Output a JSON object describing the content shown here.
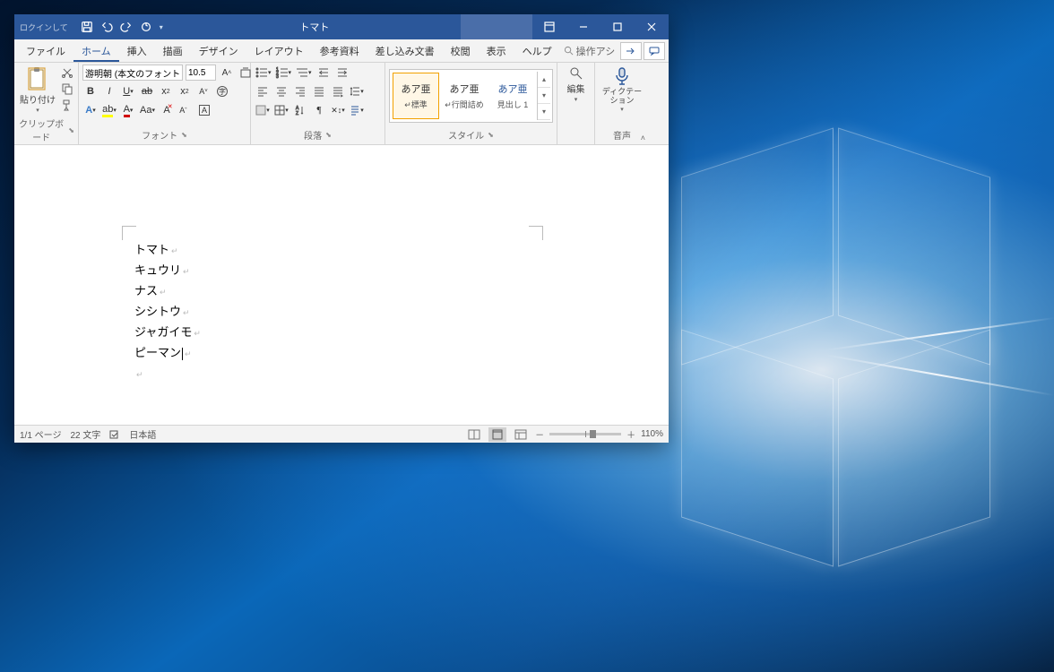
{
  "titlebar": {
    "badge": "ロクインして",
    "doc_title": "トマト"
  },
  "window_controls": {
    "min": "—",
    "max": "▢",
    "close": "✕"
  },
  "menu": {
    "items": [
      "ファイル",
      "ホーム",
      "挿入",
      "描画",
      "デザイン",
      "レイアウト",
      "参考資料",
      "差し込み文書",
      "校閲",
      "表示",
      "ヘルプ"
    ],
    "active_index": 1,
    "search_placeholder": "操作アシ"
  },
  "ribbon": {
    "clipboard": {
      "paste": "貼り付け",
      "group_label": "クリップボード"
    },
    "font": {
      "font_name": "游明朝 (本文のフォント - 日",
      "font_size": "10.5",
      "group_label": "フォント"
    },
    "paragraph": {
      "group_label": "段落"
    },
    "styles": {
      "items": [
        {
          "sample": "あア亜",
          "name": "標準",
          "selected": true,
          "prefix": "↵"
        },
        {
          "sample": "あア亜",
          "name": "行間詰め",
          "selected": false,
          "prefix": "↵"
        },
        {
          "sample": "あア亜",
          "name": "見出し 1",
          "selected": false,
          "prefix": ""
        }
      ],
      "group_label": "スタイル"
    },
    "editing": {
      "label": "編集"
    },
    "voice": {
      "label": "ディクテーション",
      "group_label": "音声"
    }
  },
  "document": {
    "lines": [
      "トマト",
      "キュウリ",
      "ナス",
      "シシトウ",
      "ジャガイモ",
      "ピーマン"
    ]
  },
  "status": {
    "page": "1/1 ページ",
    "words": "22 文字",
    "lang": "日本語",
    "zoom": "110%"
  }
}
